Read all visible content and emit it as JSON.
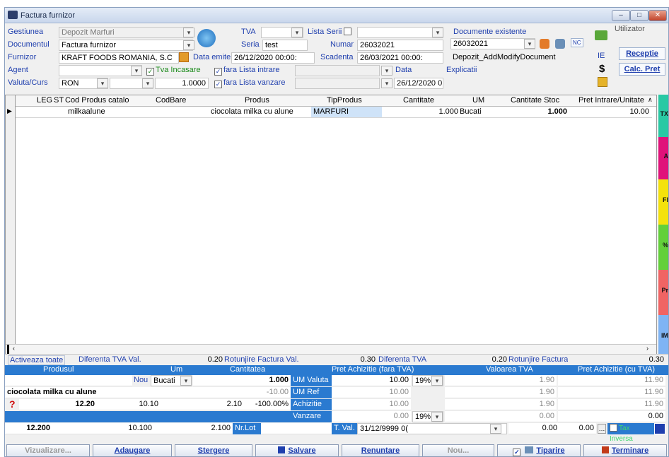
{
  "window": {
    "title": "Factura furnizor"
  },
  "form": {
    "gestiunea_label": "Gestiunea",
    "gestiunea_value": "Depozit Marfuri",
    "documentul_label": "Documentul",
    "documentul_value": "Factura furnizor",
    "furnizor_label": "Furnizor",
    "furnizor_value": "KRAFT FOODS ROMANIA, S.C",
    "agent_label": "Agent",
    "valuta_label": "Valuta/Curs",
    "valuta_value": "RON",
    "curs_value": "1.0000",
    "tva_label": "TVA",
    "lista_serii_label": "Lista Serii",
    "seria_label": "Seria",
    "seria_value": "test",
    "numar_label": "Numar",
    "numar_value": "26032021",
    "data_emiterii_label": "Data emiterii",
    "data_emiterii_value": "26/12/2020 00:00:",
    "scadenta_label": "Scadenta",
    "scadenta_value": "26/03/2021 00:00:",
    "tva_incasare_label": "Tva Incasare",
    "fara_lista_intrare_label": "fara Lista intrare",
    "fara_lista_vanzare_label": "fara Lista vanzare",
    "data_label": "Data",
    "data_value": "26/12/2020 0",
    "explicatii_label": "Explicatii",
    "documente_existente_label": "Documente existente",
    "documente_existente_value": "26032021",
    "nc_label": "NC",
    "ie_label": "IE",
    "depozit_text": "Depozit_AddModifyDocument",
    "utilizator_label": "Utilizator",
    "receptie_label": "Receptie",
    "calc_pret_label": "Calc. Pret",
    "dollar": "$"
  },
  "grid": {
    "headers": [
      "LEG",
      "ST",
      "Cod Produs catalo",
      "CodBare",
      "Produs",
      "TipProdus",
      "Cantitate",
      "UM",
      "Cantitate Stoc",
      "Pret Intrare/Unitate"
    ],
    "row": {
      "cod": "milkaalune",
      "codbare": "",
      "produs": "ciocolata milka cu alune",
      "tip": "MARFURI",
      "cantitate": "1.000",
      "um": "Bucati",
      "stoc": "1.000",
      "pret": "10.00"
    },
    "side_tabs": [
      "TX",
      "A",
      "FI",
      "%",
      "Pr",
      "IM"
    ]
  },
  "totals": {
    "activeaza": "Activeaza toate",
    "dif_tva_val_label": "Diferenta TVA Val.",
    "dif_tva_val": "0.20",
    "rotunjire_val_label": "Rotunjire Factura Val.",
    "rotunjire_val": "0.30",
    "dif_tva_label": "Diferenta TVA",
    "dif_tva": "0.20",
    "rotunjire_label": "Rotunjire Factura",
    "rotunjire": "0.30"
  },
  "panel": {
    "headers": [
      "Produsul",
      "Um",
      "Cantitatea",
      "Pret Achizitie (fara TVA)",
      "Valoarea TVA",
      "Pret Achizitie (cu TVA)"
    ],
    "nou": "Nou",
    "um": "Bucati",
    "cant": "1.000",
    "cant_neg": "-10.00",
    "lbl_um_valuta": "UM Valuta",
    "lbl_um_ref": "UM Ref Va",
    "lbl_achizitie": "Achizitie",
    "lbl_vanzare": "Vanzare",
    "lbl_nrlot": "Nr.Lot",
    "lbl_tval": "T. Val.",
    "produs": "ciocolata milka cu alune",
    "q": "?",
    "v1": "12.20",
    "v2": "10.10",
    "v3": "2.10",
    "v4": "-100.00%",
    "p1": "10.00",
    "p2": "10.00",
    "p3": "10.00",
    "p4": "0.00",
    "tva1": "19%",
    "tva4": "19%",
    "t1": "1.90",
    "t2": "1.90",
    "t3": "1.90",
    "t4": "0.00",
    "c1": "11.90",
    "c2": "11.90",
    "c3": "11.90",
    "c4": "0.00",
    "b1": "12.200",
    "b2": "10.100",
    "b3": "2.100",
    "tval": "31/12/9999 0(",
    "z1": "0.00",
    "z2": "0.00",
    "tax_inversa": "Tax Inversa"
  },
  "buttons": {
    "vizualizare": "Vizualizare...",
    "adaugare": "Adaugare",
    "stergere": "Stergere",
    "salvare": "Salvare",
    "renuntare": "Renuntare",
    "nou": "Nou...",
    "tiparire": "Tiparire",
    "terminare": "Terminare"
  },
  "colors": {
    "blue_bar": "#2a7ad0",
    "label": "#1f3fae",
    "selected": "#cfe3f8"
  }
}
